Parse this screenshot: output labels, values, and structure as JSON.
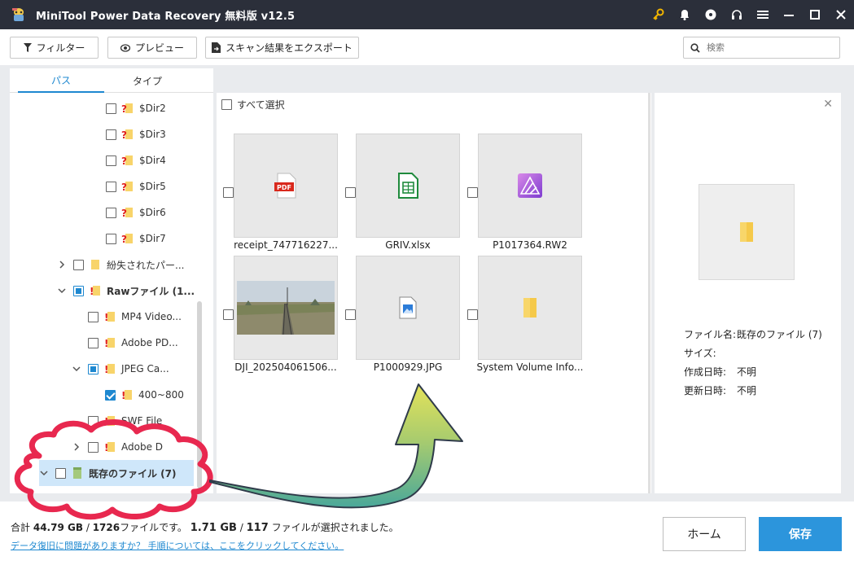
{
  "window": {
    "title": "MiniTool Power Data Recovery 無料版 v12.5"
  },
  "toolbar": {
    "filter_label": "フィルター",
    "preview_label": "プレビュー",
    "export_label": "スキャン結果をエクスポート",
    "search_placeholder": "検索"
  },
  "tabs": {
    "path": "パス",
    "type": "タイプ"
  },
  "tree": {
    "dir2": "$Dir2",
    "dir3": "$Dir3",
    "dir4": "$Dir4",
    "dir5": "$Dir5",
    "dir6": "$Dir6",
    "dir7": "$Dir7",
    "lost_partition": "紛失されたパー...",
    "raw_files": "Rawファイル (1...",
    "mp4": "MP4 Video...",
    "adobe_pdf": "Adobe PD...",
    "jpeg": "JPEG Ca...",
    "range": "400~800",
    "swf": "SWF File",
    "adobe_d": "Adobe D",
    "existing_files": "既存のファイル (7)"
  },
  "grid": {
    "select_all": "すべて選択",
    "files": [
      {
        "name": "receipt_747716227...",
        "icon": "pdf-file-icon"
      },
      {
        "name": "GRIV.xlsx",
        "icon": "excel-file-icon"
      },
      {
        "name": "P1017364.RW2",
        "icon": "raw-image-icon"
      },
      {
        "name": "DJI_202504061506...",
        "icon": "photo-thumbnail"
      },
      {
        "name": "P1000929.JPG",
        "icon": "image-file-icon"
      },
      {
        "name": "System Volume Info...",
        "icon": "folder-icon"
      }
    ]
  },
  "preview": {
    "name_label": "ファイル名:",
    "name_value": "既存のファイル (7)",
    "size_label": "サイズ:",
    "size_value": "",
    "created_label": "作成日時:",
    "created_value": "不明",
    "modified_label": "更新日時:",
    "modified_value": "不明"
  },
  "footer": {
    "summary_prefix": "合計",
    "total_size": "44.79 GB",
    "slash": "/",
    "total_files": "1726",
    "files_suffix": "ファイルです。",
    "selected_size": "1.71 GB",
    "selected_files": "117",
    "selected_suffix": "ファイルが選択されました。",
    "help_link": "データ復旧に問題がありますか？ 手順については、ここをクリックしてください。",
    "home_label": "ホーム",
    "save_label": "保存"
  },
  "colors": {
    "titlebar": "#2b2f3a",
    "accent": "#1e88d0",
    "save_button": "#2c95dc",
    "highlight_cloud": "#e8284f",
    "arrow_fill_top": "#e3e25a",
    "arrow_fill_bottom": "#4aa89a"
  }
}
